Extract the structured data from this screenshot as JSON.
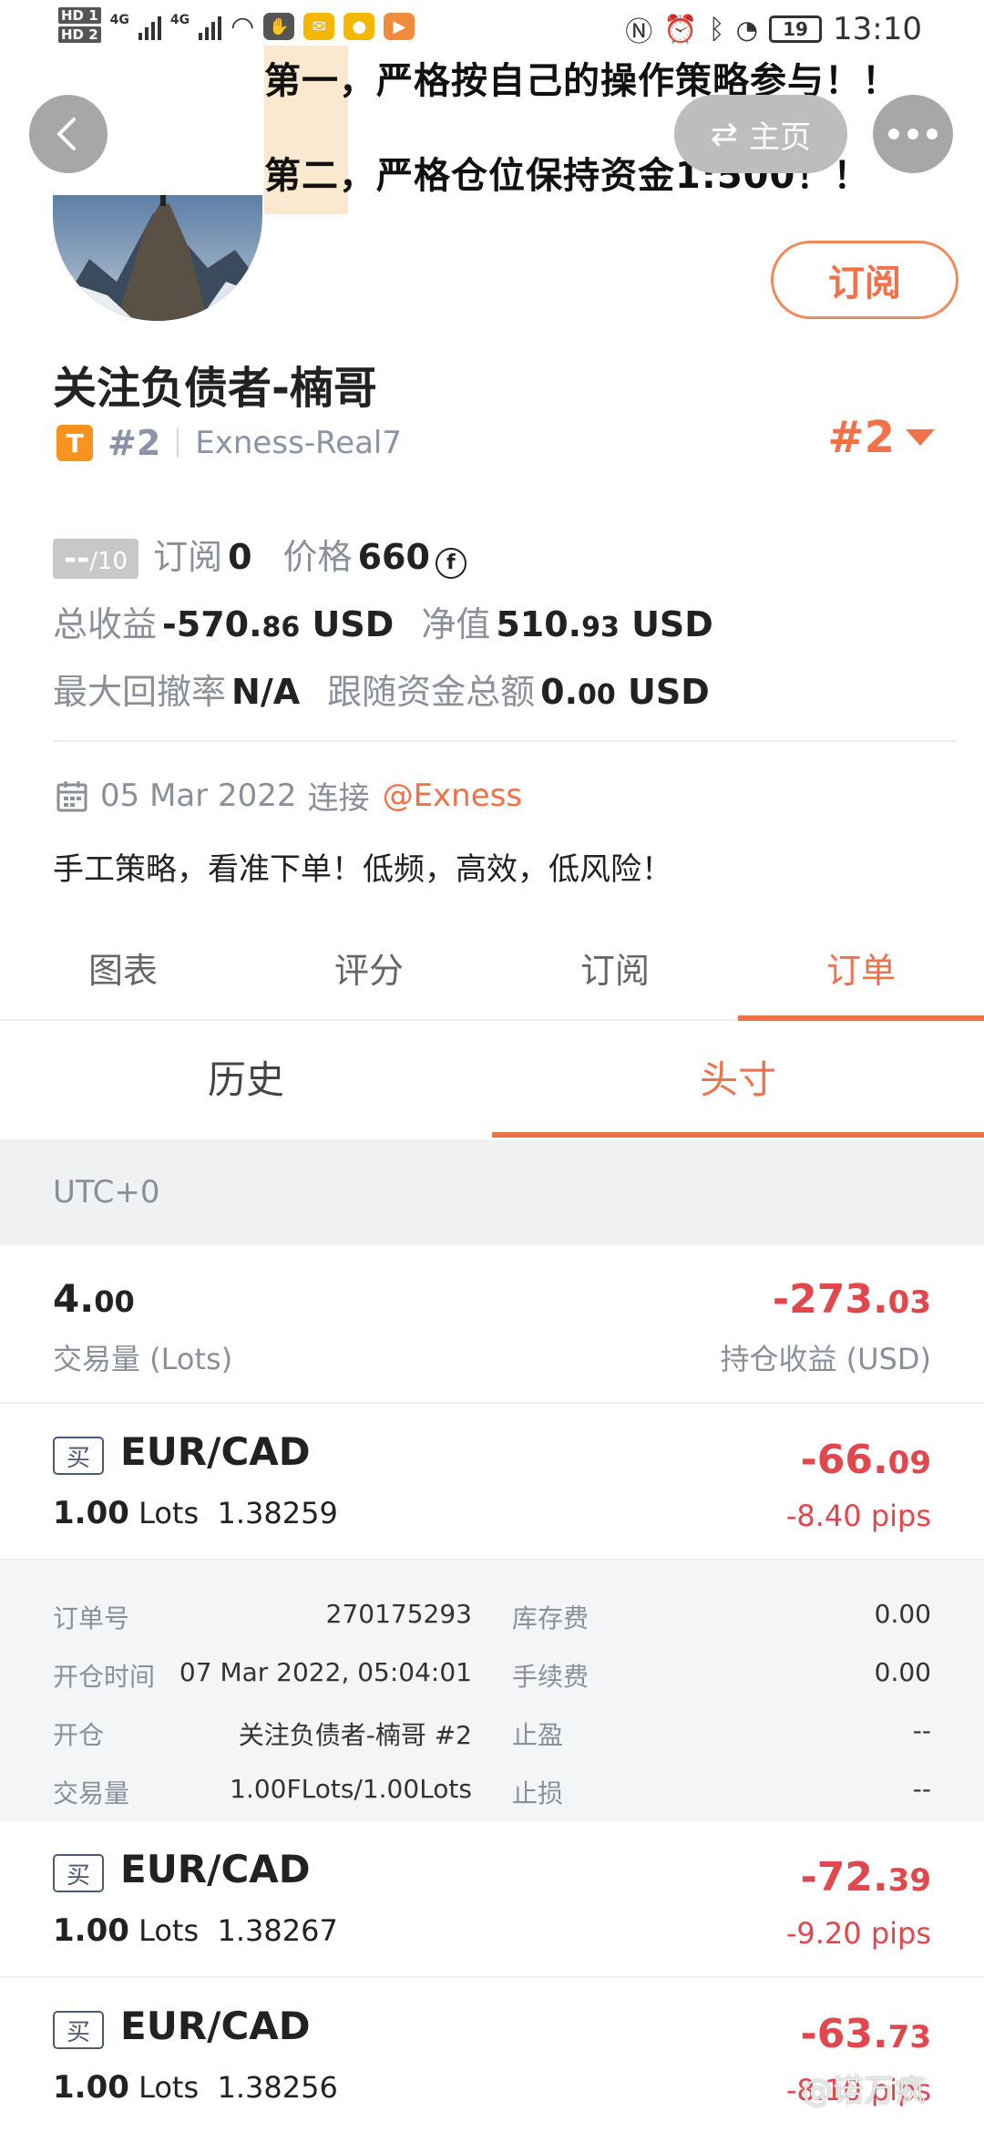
{
  "status_bar": {
    "left_badges": [
      "HD 1",
      "HD 2"
    ],
    "network_labels": [
      "4G",
      "4G"
    ],
    "battery": "19",
    "time": "13:10"
  },
  "banner": {
    "line1": "第一，严格按自己的操作策略参与！！",
    "line2": "第二，严格仓位保持资金1:500！！"
  },
  "header": {
    "home_label": "主页",
    "back_icon": "chevron-left-icon",
    "more_icon": "more-dots-icon",
    "subscribe_label": "订阅"
  },
  "profile": {
    "name": "关注负债者-楠哥",
    "tier_badge": "T",
    "rank": "#2",
    "server": "Exness-Real7",
    "rank_right": "#2",
    "score": "--",
    "score_max": "/10",
    "subscribe_label": "订阅",
    "subscribe_count": "0",
    "price_label": "价格",
    "price": "660",
    "currency_symbol": "f",
    "total_profit_label": "总收益",
    "total_profit_int": "-570.",
    "total_profit_dec": "86",
    "total_profit_unit": "USD",
    "equity_label": "净值",
    "equity_int": "510.",
    "equity_dec": "93",
    "equity_unit": "USD",
    "max_drawdown_label": "最大回撤率",
    "max_drawdown": "N/A",
    "follow_total_label": "跟随资金总额",
    "follow_total_int": "0.",
    "follow_total_dec": "00",
    "follow_total_unit": "USD",
    "connected_date": "05 Mar 2022",
    "connected_label": "连接",
    "broker": "@Exness",
    "description": "手工策略，看准下单！低频，高效，低风险！"
  },
  "tabs": [
    "图表",
    "评分",
    "订阅",
    "订单"
  ],
  "active_tab": 3,
  "subtabs": [
    "历史",
    "头寸"
  ],
  "active_subtab": 1,
  "timezone": "UTC+0",
  "summary": {
    "lots_int": "4.",
    "lots_dec": "00",
    "lots_label": "交易量 (Lots)",
    "pl_int": "-273.",
    "pl_dec": "03",
    "pl_label": "持仓收益 (USD)"
  },
  "orders": [
    {
      "side": "买",
      "symbol": "EUR/CAD",
      "lots": "1.00",
      "lots_unit": "Lots",
      "price": "1.38259",
      "pl_int": "-66.",
      "pl_dec": "09",
      "pips": "-8.40 pips"
    },
    {
      "side": "买",
      "symbol": "EUR/CAD",
      "lots": "1.00",
      "lots_unit": "Lots",
      "price": "1.38267",
      "pl_int": "-72.",
      "pl_dec": "39",
      "pips": "-9.20 pips"
    },
    {
      "side": "买",
      "symbol": "EUR/CAD",
      "lots": "1.00",
      "lots_unit": "Lots",
      "price": "1.38256",
      "pl_int": "-63.",
      "pl_dec": "73",
      "pips": "-8.10 pips"
    }
  ],
  "order_details": [
    {
      "label1": "订单号",
      "value1": "270175293",
      "label2": "库存费",
      "value2": "0.00"
    },
    {
      "label1": "开仓时间",
      "value1": "07 Mar 2022, 05:04:01",
      "label2": "手续费",
      "value2": "0.00"
    },
    {
      "label1": "开仓",
      "value1": "关注负债者-楠哥  #2",
      "label2": "止盈",
      "value2": "--"
    },
    {
      "label1": "交易量",
      "value1": "1.00FLots/1.00Lots",
      "label2": "止损",
      "value2": "--"
    }
  ],
  "watermark": "@诺万疯"
}
